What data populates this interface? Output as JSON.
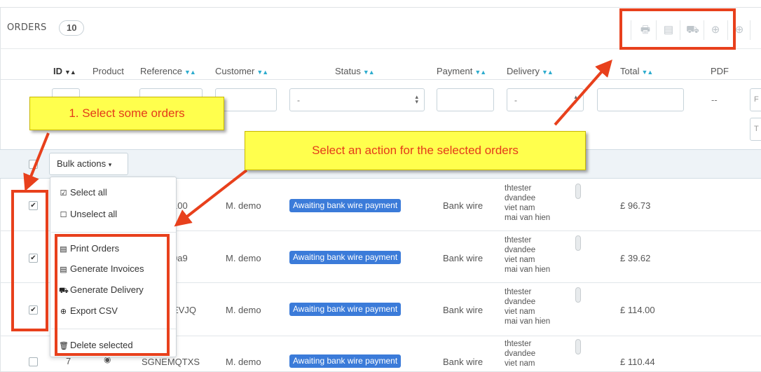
{
  "panel": {
    "title": "ORDERS",
    "count": "10"
  },
  "toolbar": {
    "icons": [
      "print-icon",
      "document-icon",
      "truck-icon",
      "download-icon",
      "add-icon"
    ]
  },
  "columns": {
    "id": "ID",
    "product": "Product",
    "reference": "Reference",
    "customer": "Customer",
    "status": "Status",
    "payment": "Payment",
    "delivery": "Delivery",
    "total": "Total",
    "pdf": "PDF"
  },
  "filters": {
    "status_value": "-",
    "delivery_value": "-",
    "pdf_value": "--",
    "date_from_prefix": "F",
    "date_to_prefix": "T"
  },
  "bulk": {
    "button_label": "Bulk actions"
  },
  "menu": {
    "select_all": "Select all",
    "unselect_all": "Unselect all",
    "print_orders": "Print Orders",
    "generate_invoices": "Generate Invoices",
    "generate_delivery": "Generate Delivery",
    "export_csv": "Export CSV",
    "delete_selected": "Delete selected"
  },
  "rows": [
    {
      "ref_fragment": "100",
      "customer": "M. demo",
      "status": "Awaiting bank wire payment",
      "payment": "Bank wire",
      "address": [
        "thtester",
        "dvandee",
        "viet nam",
        "mai van hien"
      ],
      "total": "£ 96.73",
      "checked": true
    },
    {
      "ref_fragment": "0a9",
      "customer": "M. demo",
      "status": "Awaiting bank wire payment",
      "payment": "Bank wire",
      "address": [
        "thtester",
        "dvandee",
        "viet nam",
        "mai van hien"
      ],
      "total": "£ 39.62",
      "checked": true
    },
    {
      "ref_fragment": "EVJQ",
      "customer": "M. demo",
      "status": "Awaiting bank wire payment",
      "payment": "Bank wire",
      "address": [
        "thtester",
        "dvandee",
        "viet nam",
        "mai van hien"
      ],
      "total": "£ 114.00",
      "checked": true
    },
    {
      "id": "7",
      "ref_fragment": "SGNEMQTXS",
      "customer": "M. demo",
      "status": "Awaiting bank wire payment",
      "payment": "Bank wire",
      "address": [
        "thtester",
        "dvandee",
        "viet nam"
      ],
      "total": "£ 110.44",
      "checked": false
    }
  ],
  "annotations": {
    "callout_select": "1. Select some orders",
    "callout_action": "Select an action for the selected orders",
    "color": "#e8401c",
    "callout_bg": "#ffff4d"
  },
  "colors": {
    "badge": "#3b7bd9",
    "sort_arrow": "#2eacce"
  }
}
